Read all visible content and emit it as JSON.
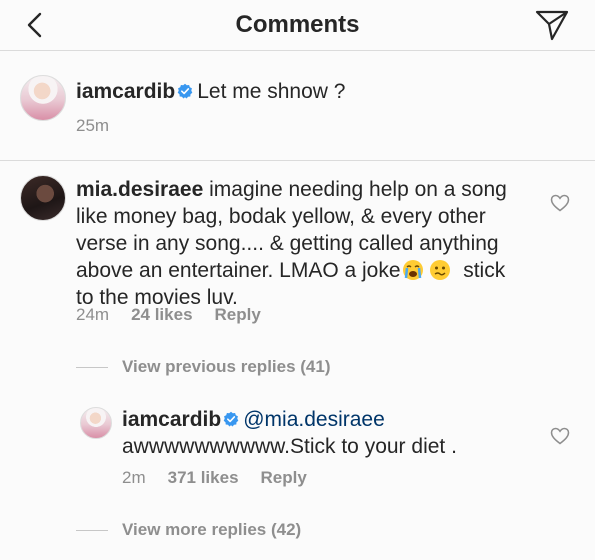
{
  "header": {
    "title": "Comments"
  },
  "caption": {
    "username": "iamcardib",
    "text": "Let me shnow ?",
    "time": "25m"
  },
  "comment": {
    "username": "mia.desiraee",
    "lines": [
      "imagine needing help on a song",
      "like money bag, bodak yellow, & every other",
      "verse in any song.... & getting called anything",
      "above an entertainer. LMAO a joke",
      "stick",
      "to the movies luv."
    ],
    "time": "24m",
    "likes": "24 likes",
    "reply_label": "Reply",
    "view_previous": "View previous replies (41)"
  },
  "reply": {
    "username": "iamcardib",
    "mention": "@mia.desiraee",
    "text": "awwwwwwwwww.Stick to your diet .",
    "time": "2m",
    "likes": "371 likes",
    "reply_label": "Reply",
    "view_more": "View more replies (42)"
  },
  "icons": {
    "back": "chevron-left-icon",
    "send": "paper-plane-icon",
    "like": "heart-outline-icon",
    "verified": "verified-badge-icon",
    "emoji_1": "crying-face-emoji",
    "emoji_2": "nauseated-face-emoji"
  },
  "colors": {
    "verified": "#3897f0",
    "muted": "#8e8e8e",
    "mention": "#003569"
  }
}
